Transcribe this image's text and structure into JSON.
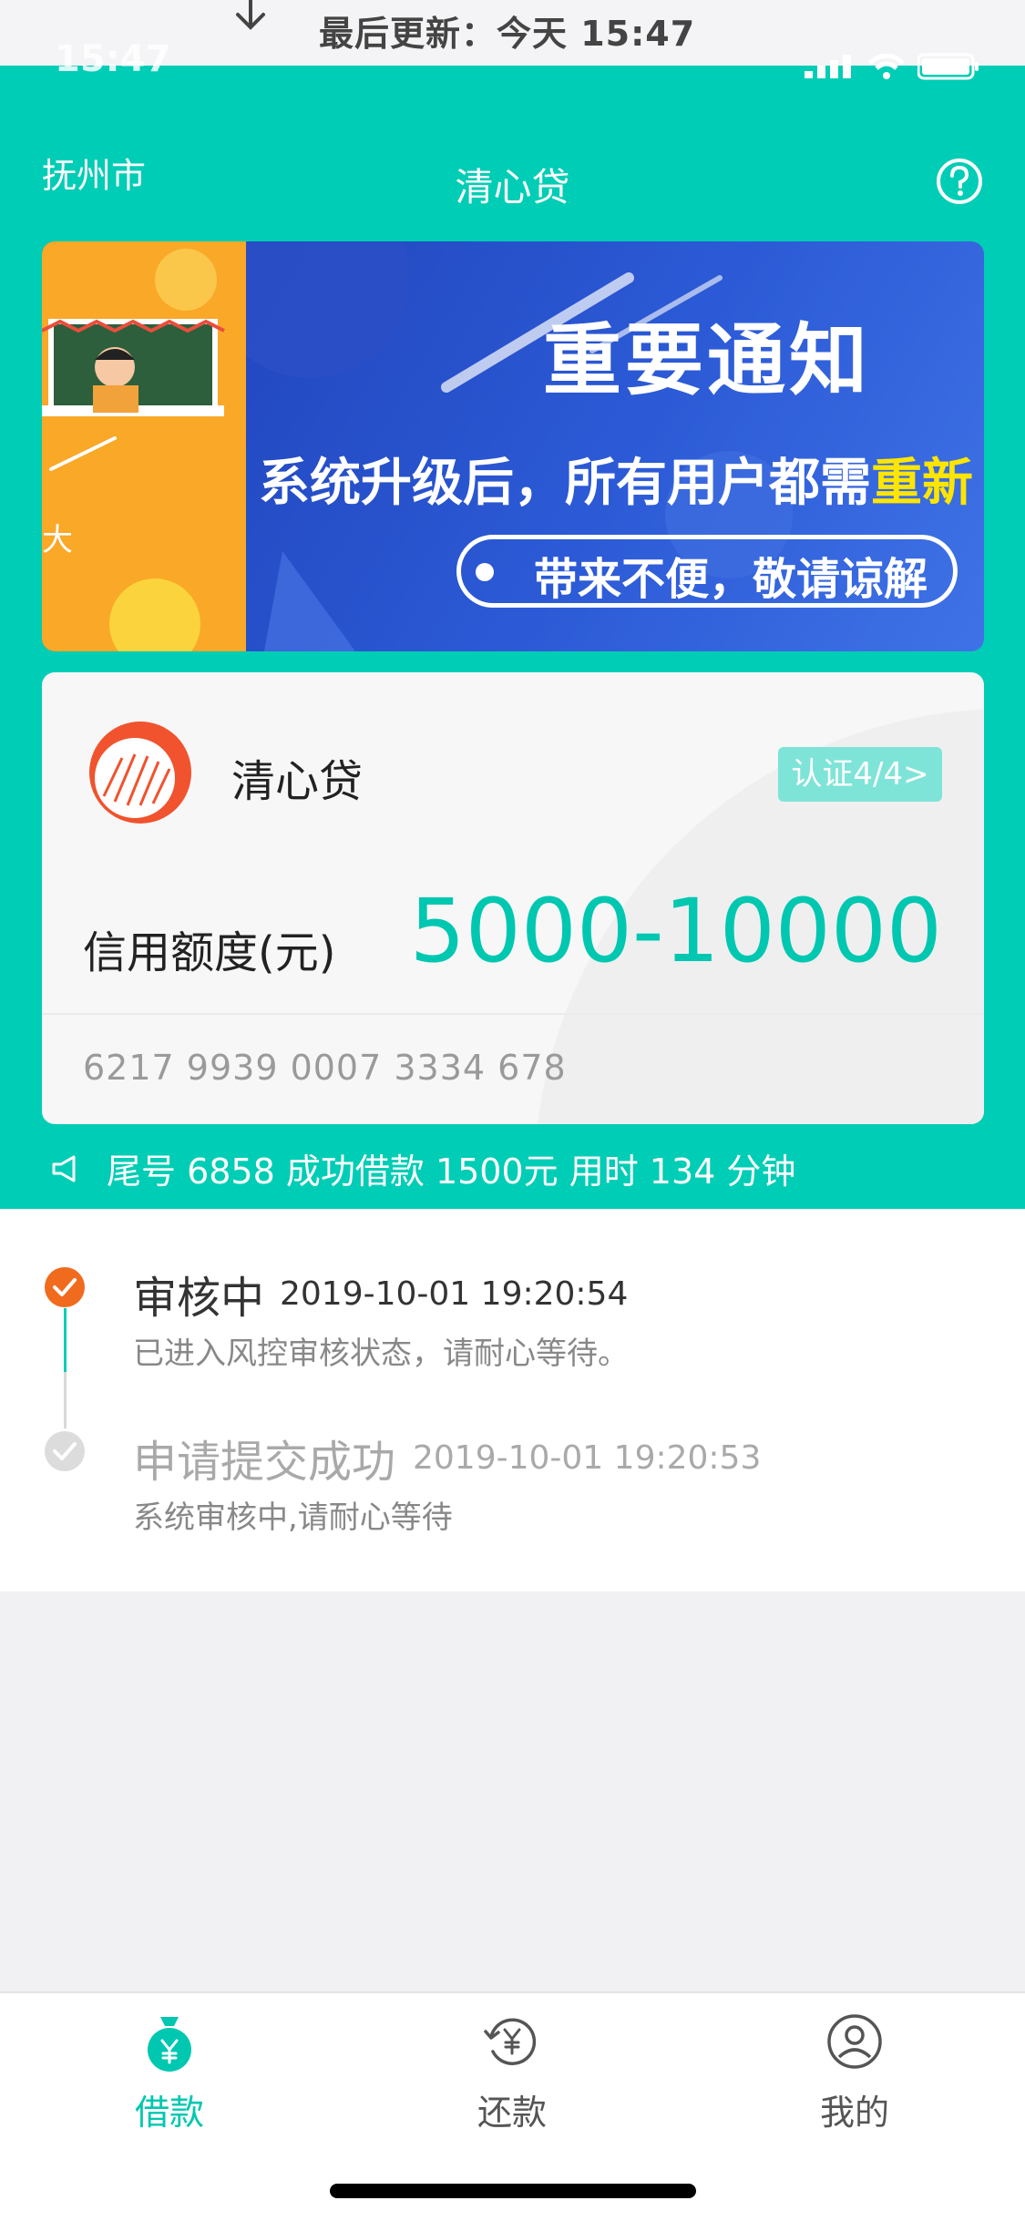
{
  "refresh": {
    "text": "最后更新：今天 15:47"
  },
  "status_bar": {
    "time": "15:47"
  },
  "header": {
    "city": "抚州市",
    "title": "清心贷"
  },
  "banner": {
    "title": "重要通知",
    "subtitle_prefix": "系统升级后，所有用户都需",
    "subtitle_highlight": "重新",
    "pill_text": "带来不便，敬请谅解",
    "side_char": "大"
  },
  "card": {
    "name": "清心贷",
    "cert_badge": "认证4/4>",
    "limit_label": "信用额度(元)",
    "limit_value": "5000-10000",
    "card_number": "6217 9939 0007 3334 678"
  },
  "notice": {
    "text": "尾号 6858 成功借款 1500元 用时 134 分钟"
  },
  "timeline": [
    {
      "title": "审核中",
      "time": "2019-10-01 19:20:54",
      "desc": "已进入风控审核状态，请耐心等待。"
    },
    {
      "title": "申请提交成功",
      "time": "2019-10-01 19:20:53",
      "desc": "系统审核中,请耐心等待"
    }
  ],
  "tabs": [
    {
      "label": "借款",
      "icon": "money-bag-icon",
      "active": true
    },
    {
      "label": "还款",
      "icon": "repay-icon",
      "active": false
    },
    {
      "label": "我的",
      "icon": "profile-icon",
      "active": false
    }
  ],
  "colors": {
    "accent": "#00cdb5",
    "active_tab": "#00c7b0",
    "inactive_tab": "#555555",
    "status_orange": "#f06b1d"
  }
}
